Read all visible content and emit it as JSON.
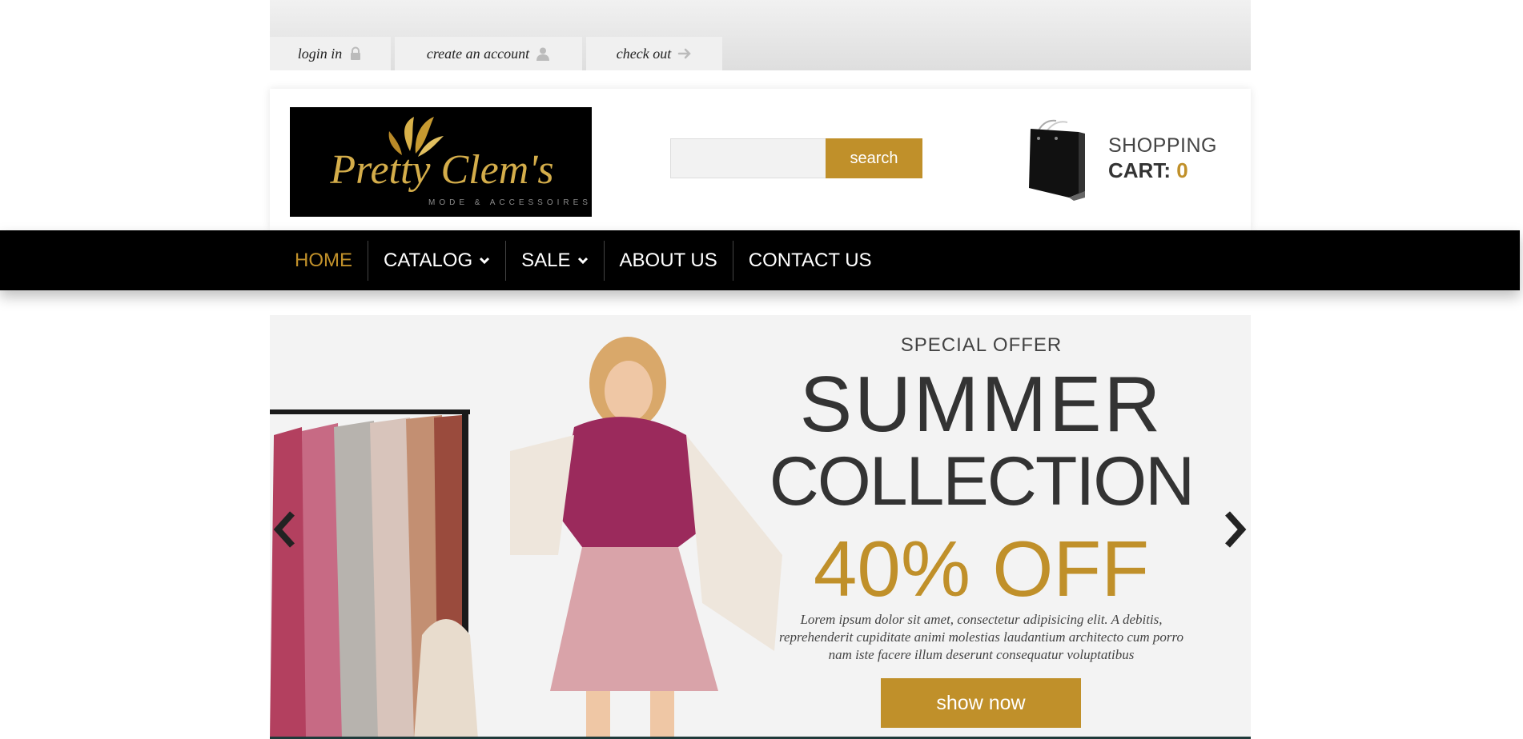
{
  "toplinks": [
    {
      "label": "login in",
      "icon": "lock-icon"
    },
    {
      "label": "create an account",
      "icon": "user-icon"
    },
    {
      "label": "check out",
      "icon": "arrow-right-icon"
    }
  ],
  "header": {
    "logo_text": "Pretty Clem's",
    "logo_tagline": "MODE & ACCESSOIRES",
    "search": {
      "placeholder": "",
      "button_label": "search"
    },
    "cart": {
      "line1": "SHOPPING",
      "label": "CART:",
      "count": "0"
    }
  },
  "nav": {
    "items": [
      {
        "label": "HOME",
        "active": true,
        "dropdown": false
      },
      {
        "label": "CATALOG",
        "active": false,
        "dropdown": true
      },
      {
        "label": "SALE",
        "active": false,
        "dropdown": true
      },
      {
        "label": "ABOUT US",
        "active": false,
        "dropdown": false
      },
      {
        "label": "CONTACT US",
        "active": false,
        "dropdown": false
      }
    ]
  },
  "slider": {
    "kicker": "SPECIAL OFFER",
    "title_line1": "SUMMER",
    "title_line2": "COLLECTION",
    "discount": "40% OFF",
    "body_line1": "Lorem ipsum dolor sit amet, consectetur adipisicing elit. A debitis,",
    "body_line2": "reprehenderit cupiditate animi molestias laudantium architecto cum porro",
    "body_line3": "nam iste facere illum deserunt consequatur voluptatibus",
    "button_label": "show now"
  },
  "colors": {
    "accent": "#c0902a",
    "nav_bg": "#000000",
    "topbar_bg": "#e6e6e6"
  }
}
